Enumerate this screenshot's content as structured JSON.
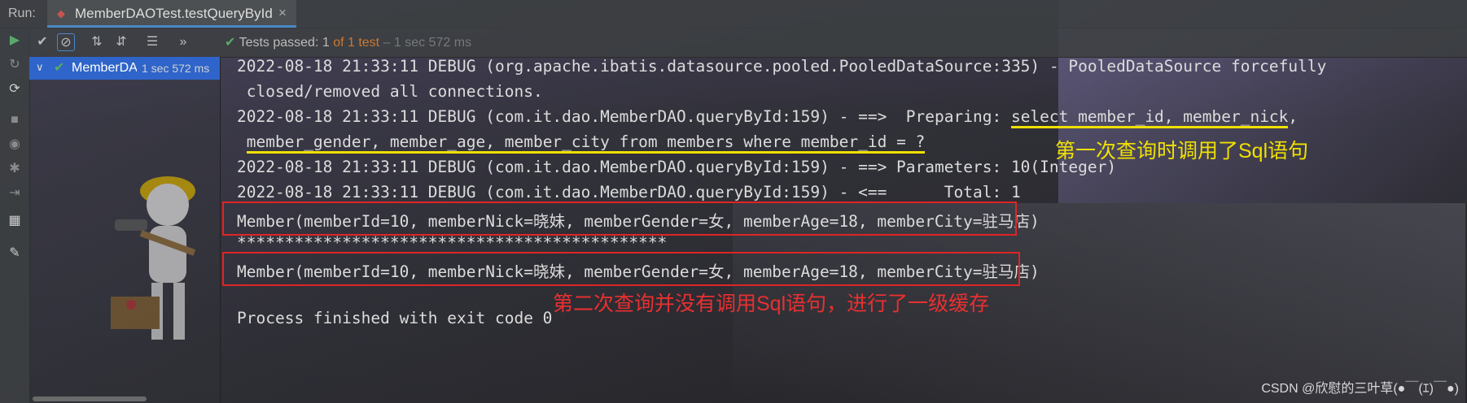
{
  "run_label": "Run:",
  "tab": {
    "title": "MemberDAOTest.testQueryById",
    "close": "×"
  },
  "toolbar": {
    "tests_passed_label": "Tests passed:",
    "tests_passed_count": "1",
    "of_total": "of 1 test",
    "duration": "– 1 sec 572 ms",
    "more": "»"
  },
  "tree": {
    "item_name": "MemberDAOTest",
    "item_duration": "1 sec 572 ms"
  },
  "console": {
    "lines": [
      "2022-08-18 21:33:11 DEBUG (org.apache.ibatis.datasource.pooled.PooledDataSource:335) - PooledDataSource forcefully",
      " closed/removed all connections.",
      "2022-08-18 21:33:11 DEBUG (com.it.dao.MemberDAO.queryById:159) - ==>  Preparing: ",
      "select member_id, member_nick",
      ",",
      "member_gender, member_age, member_city from members where member_id = ?",
      "2022-08-18 21:33:11 DEBUG (com.it.dao.MemberDAO.queryById:159) - ==> Parameters: 10(Integer)",
      "2022-08-18 21:33:11 DEBUG (com.it.dao.MemberDAO.queryById:159) - <==      Total: 1",
      "Member(memberId=10, memberNick=晓妹, memberGender=女, memberAge=18, memberCity=驻马店)",
      "*********************************************",
      "Member(memberId=10, memberNick=晓妹, memberGender=女, memberAge=18, memberCity=驻马店)",
      "",
      "Process finished with exit code 0"
    ]
  },
  "annotations": {
    "first_query": "第一次查询时调用了Sql语句",
    "second_query": "第二次查询并没有调用Sql语句，进行了一级缓存"
  },
  "watermark": "CSDN @欣慰的三叶草(●￣(ｴ)￣●)",
  "colors": {
    "annotation_yellow": "#f0e000",
    "annotation_red": "#e83030",
    "box_red": "#e02424",
    "pass_green": "#59a869",
    "selection_blue": "#2f65ca"
  },
  "icons": [
    "run-icon",
    "rerun-icon",
    "stop-icon",
    "show-passed-icon",
    "show-ignored-icon",
    "sort-alpha-icon",
    "sort-duration-icon",
    "expand-all-icon",
    "pin-icon",
    "camera-icon",
    "settings-icon",
    "exit-icon",
    "layout-icon"
  ]
}
